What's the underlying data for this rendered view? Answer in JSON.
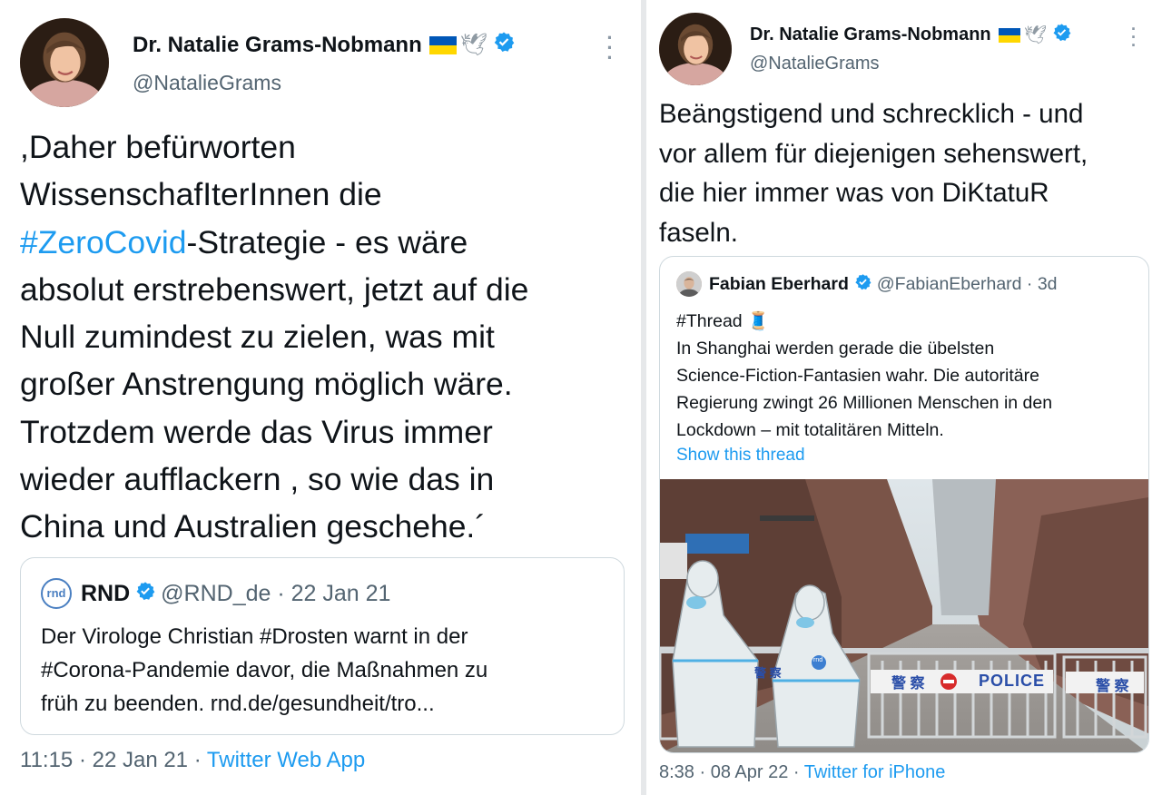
{
  "left_tweet": {
    "author": {
      "name": "Dr. Natalie Grams-Nobmann",
      "handle": "@NatalieGrams"
    },
    "text": {
      "line1": ",Daher befürworten",
      "line2": "WissenschafIterInnen die",
      "line3_tag": "#ZeroCovid",
      "line3_rest": "-Strategie - es wäre",
      "line4": "absolut erstrebenswert, jetzt auf die",
      "line5": "Null zumindest zu zielen, was mit",
      "line6": "großer Anstrengung möglich wäre.",
      "line7": "Trotzdem werde das Virus immer",
      "line8": "wieder aufflackern , so wie das in",
      "line9": "China und Australien geschehe.´"
    },
    "quote": {
      "name": "RND",
      "logo_text": "rnd",
      "meta": "@RND_de · 22 Jan 21",
      "line1": "Der Virologe Christian #Drosten warnt in der",
      "line2": "#Corona-Pandemie davor, die Maßnahmen zu",
      "line3": "früh zu beenden.  rnd.de/gesundheit/tro..."
    },
    "footer": {
      "time": "11:15 · 22 Jan 21 · ",
      "source": "Twitter Web App"
    }
  },
  "right_tweet": {
    "author": {
      "name": "Dr. Natalie Grams-Nobmann",
      "handle": "@NatalieGrams"
    },
    "text": {
      "line1": "Beängstigend und schrecklich - und",
      "line2": "vor allem für diejenigen sehenswert,",
      "line3": "die hier immer was von DiKtatuR",
      "line4": "faseln."
    },
    "quote": {
      "name": "Fabian Eberhard",
      "meta": "@FabianEberhard · 3d",
      "line1": "#Thread 🧵",
      "line2": "In Shanghai werden gerade die übelsten",
      "line3": "Science-Fiction-Fantasien wahr. Die autoritäre",
      "line4": "Regierung zwingt 26 Millionen Menschen in den",
      "line5": "Lockdown – mit totalitären Mitteln.",
      "show_thread": "Show this thread",
      "photo": {
        "police_sign": "POLICE",
        "barrier_text_1": "警 察",
        "barrier_text_2": "警 察",
        "barrier_text_3": "警 察",
        "suit_badge": "rnd"
      }
    },
    "footer": {
      "time": "8:38 · 08 Apr 22 · ",
      "source": "Twitter for iPhone"
    }
  },
  "colors": {
    "accent": "#1d9bf0",
    "text": "#0f1419",
    "muted": "#536471",
    "border": "#cfd9de",
    "flag_blue": "#0057b7",
    "flag_yellow": "#ffd700"
  },
  "icons": {
    "verified": "verified-badge-icon",
    "dove": "dove-icon",
    "more": "more-options-icon",
    "flag": "ukraine-flag-icon",
    "thread": "thread-spool-icon"
  }
}
